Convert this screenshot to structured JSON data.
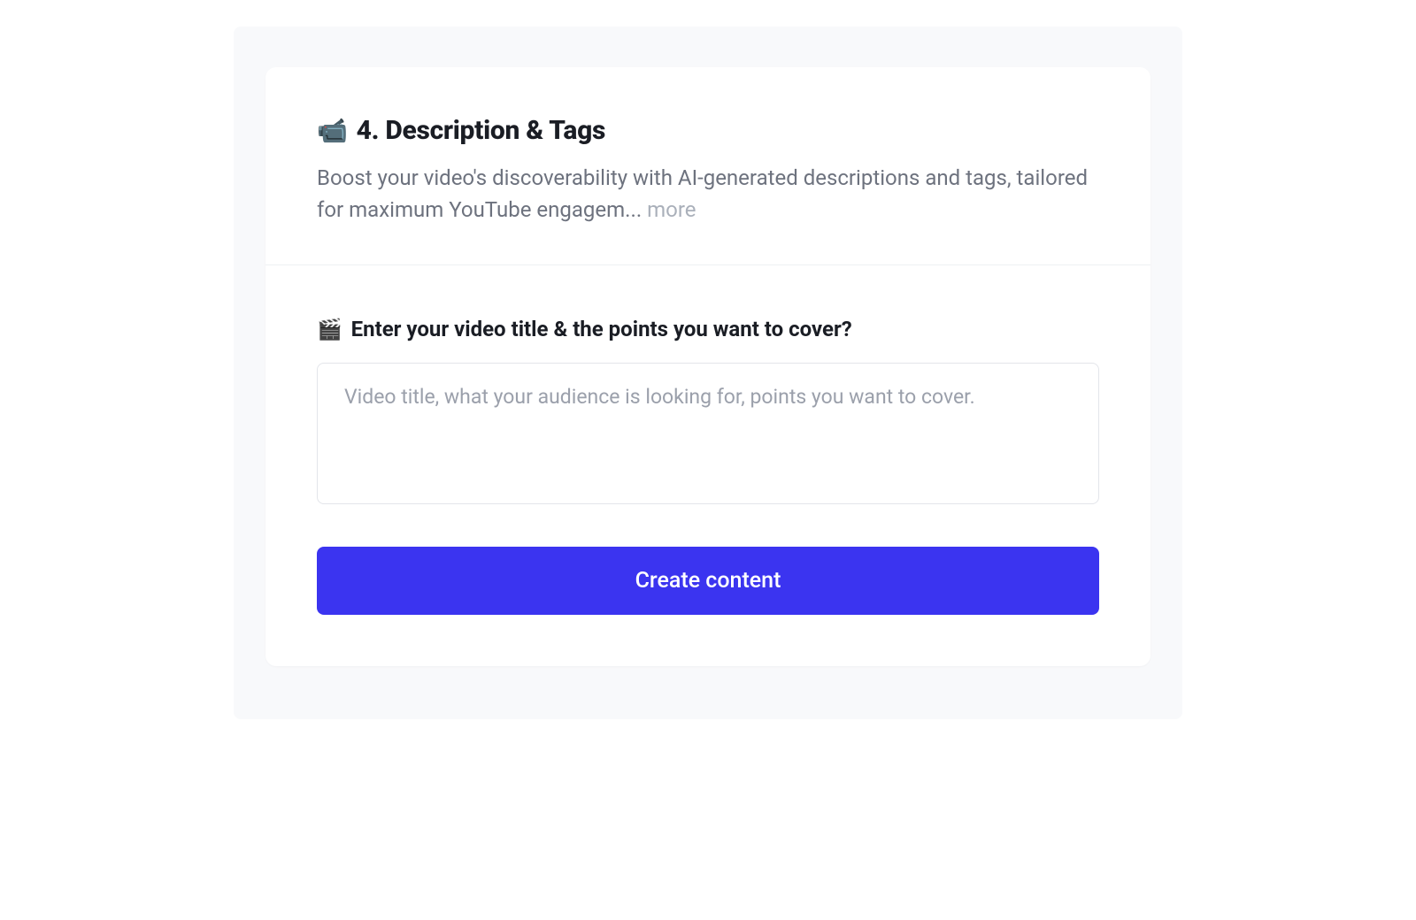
{
  "card": {
    "header": {
      "icon": "📹",
      "title": "4. Description & Tags",
      "description": "Boost your video's discoverability with AI-generated descriptions and tags, tailored for maximum YouTube engagem... ",
      "more_label": "more"
    },
    "body": {
      "field": {
        "icon": "🎬",
        "label": "Enter your video title & the points you want to cover?",
        "placeholder": "Video title, what your audience is looking for, points you want to cover.",
        "value": ""
      },
      "submit_label": "Create content"
    }
  },
  "colors": {
    "primary": "#3b34f0",
    "text_dark": "#1a1d24",
    "text_muted": "#6d727e",
    "text_light": "#aab0ba",
    "border": "#e3e5ea",
    "panel_bg": "#f8f9fb"
  }
}
